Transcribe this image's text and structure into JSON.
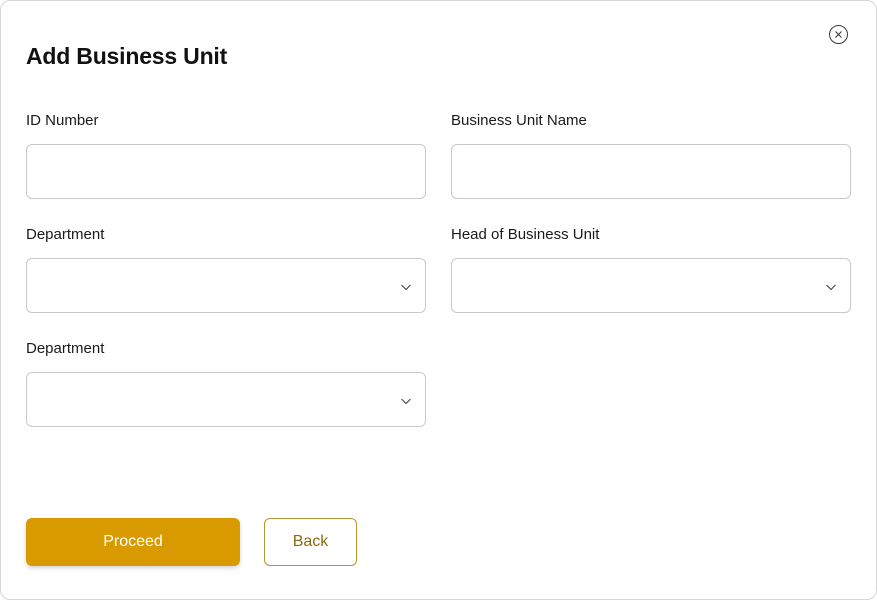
{
  "dialog": {
    "title": "Add Business Unit",
    "close_icon": "close-circle-icon"
  },
  "form": {
    "id_number": {
      "label": "ID Number",
      "value": "",
      "placeholder": ""
    },
    "business_unit_name": {
      "label": "Business Unit Name",
      "value": "",
      "placeholder": ""
    },
    "department_1": {
      "label": "Department",
      "value": "",
      "icon": "chevron-down-icon"
    },
    "head_of_business_unit": {
      "label": "Head of Business Unit",
      "value": "",
      "icon": "chevron-down-icon"
    },
    "department_2": {
      "label": "Department",
      "value": "",
      "icon": "chevron-down-icon"
    }
  },
  "actions": {
    "proceed_label": "Proceed",
    "back_label": "Back"
  },
  "colors": {
    "primary": "#d99a00",
    "secondary_border": "#b8952e",
    "secondary_text": "#8a6a10",
    "border": "#c9c9c9"
  }
}
